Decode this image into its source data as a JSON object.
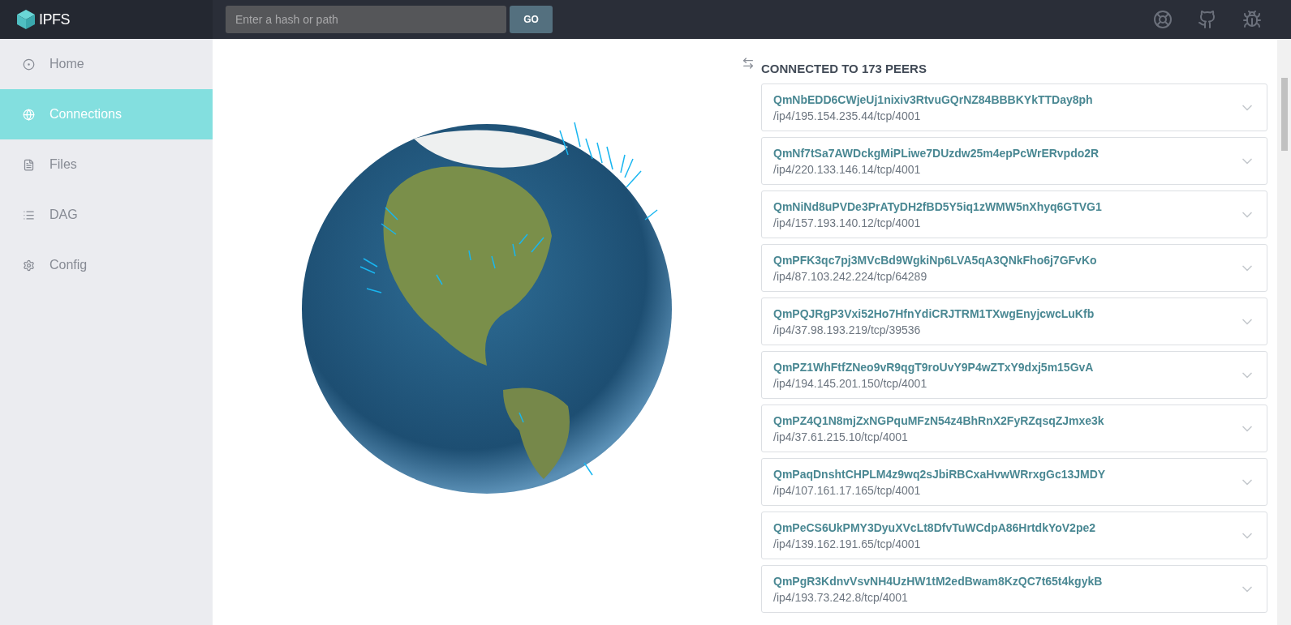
{
  "header": {
    "logo": "IPFS",
    "search": {
      "placeholder": "Enter a hash or path"
    },
    "go_button": "GO"
  },
  "sidebar": {
    "items": [
      {
        "label": "Home",
        "kind": "home",
        "selected": false
      },
      {
        "label": "Connections",
        "kind": "globe",
        "selected": true
      },
      {
        "label": "Files",
        "kind": "file",
        "selected": false
      },
      {
        "label": "DAG",
        "kind": "dag",
        "selected": false
      },
      {
        "label": "Config",
        "kind": "gear",
        "selected": false
      }
    ]
  },
  "peers": {
    "title": "CONNECTED TO 173 PEERS",
    "items": [
      {
        "id": "QmNbEDD6CWjeUj1nixiv3RtvuGQrNZ84BBBKYkTTDay8ph",
        "address": "/ip4/195.154.235.44/tcp/4001"
      },
      {
        "id": "QmNf7tSa7AWDckgMiPLiwe7DUzdw25m4epPcWrERvpdo2R",
        "address": "/ip4/220.133.146.14/tcp/4001"
      },
      {
        "id": "QmNiNd8uPVDe3PrATyDH2fBD5Y5iq1zWMW5nXhyq6GTVG1",
        "address": "/ip4/157.193.140.12/tcp/4001"
      },
      {
        "id": "QmPFK3qc7pj3MVcBd9WgkiNp6LVA5qA3QNkFho6j7GFvKo",
        "address": "/ip4/87.103.242.224/tcp/64289"
      },
      {
        "id": "QmPQJRgP3Vxi52Ho7HfnYdiCRJTRM1TXwgEnyjcwcLuKfb",
        "address": "/ip4/37.98.193.219/tcp/39536"
      },
      {
        "id": "QmPZ1WhFtfZNeo9vR9qgT9roUvY9P4wZTxY9dxj5m15GvA",
        "address": "/ip4/194.145.201.150/tcp/4001"
      },
      {
        "id": "QmPZ4Q1N8mjZxNGPquMFzN54z4BhRnX2FyRZqsqZJmxe3k",
        "address": "/ip4/37.61.215.10/tcp/4001"
      },
      {
        "id": "QmPaqDnshtCHPLM4z9wq2sJbiRBCxaHvwWRrxgGc13JMDY",
        "address": "/ip4/107.161.17.165/tcp/4001"
      },
      {
        "id": "QmPeCS6UkPMY3DyuXVcLt8DfvTuWCdpA86HrtdkYoV2pe2",
        "address": "/ip4/139.162.191.65/tcp/4001"
      },
      {
        "id": "QmPgR3KdnvVsvNH4UzHW1tM2edBwam8KzQC7t65t4kgykB",
        "address": "/ip4/193.73.242.8/tcp/4001"
      }
    ]
  }
}
